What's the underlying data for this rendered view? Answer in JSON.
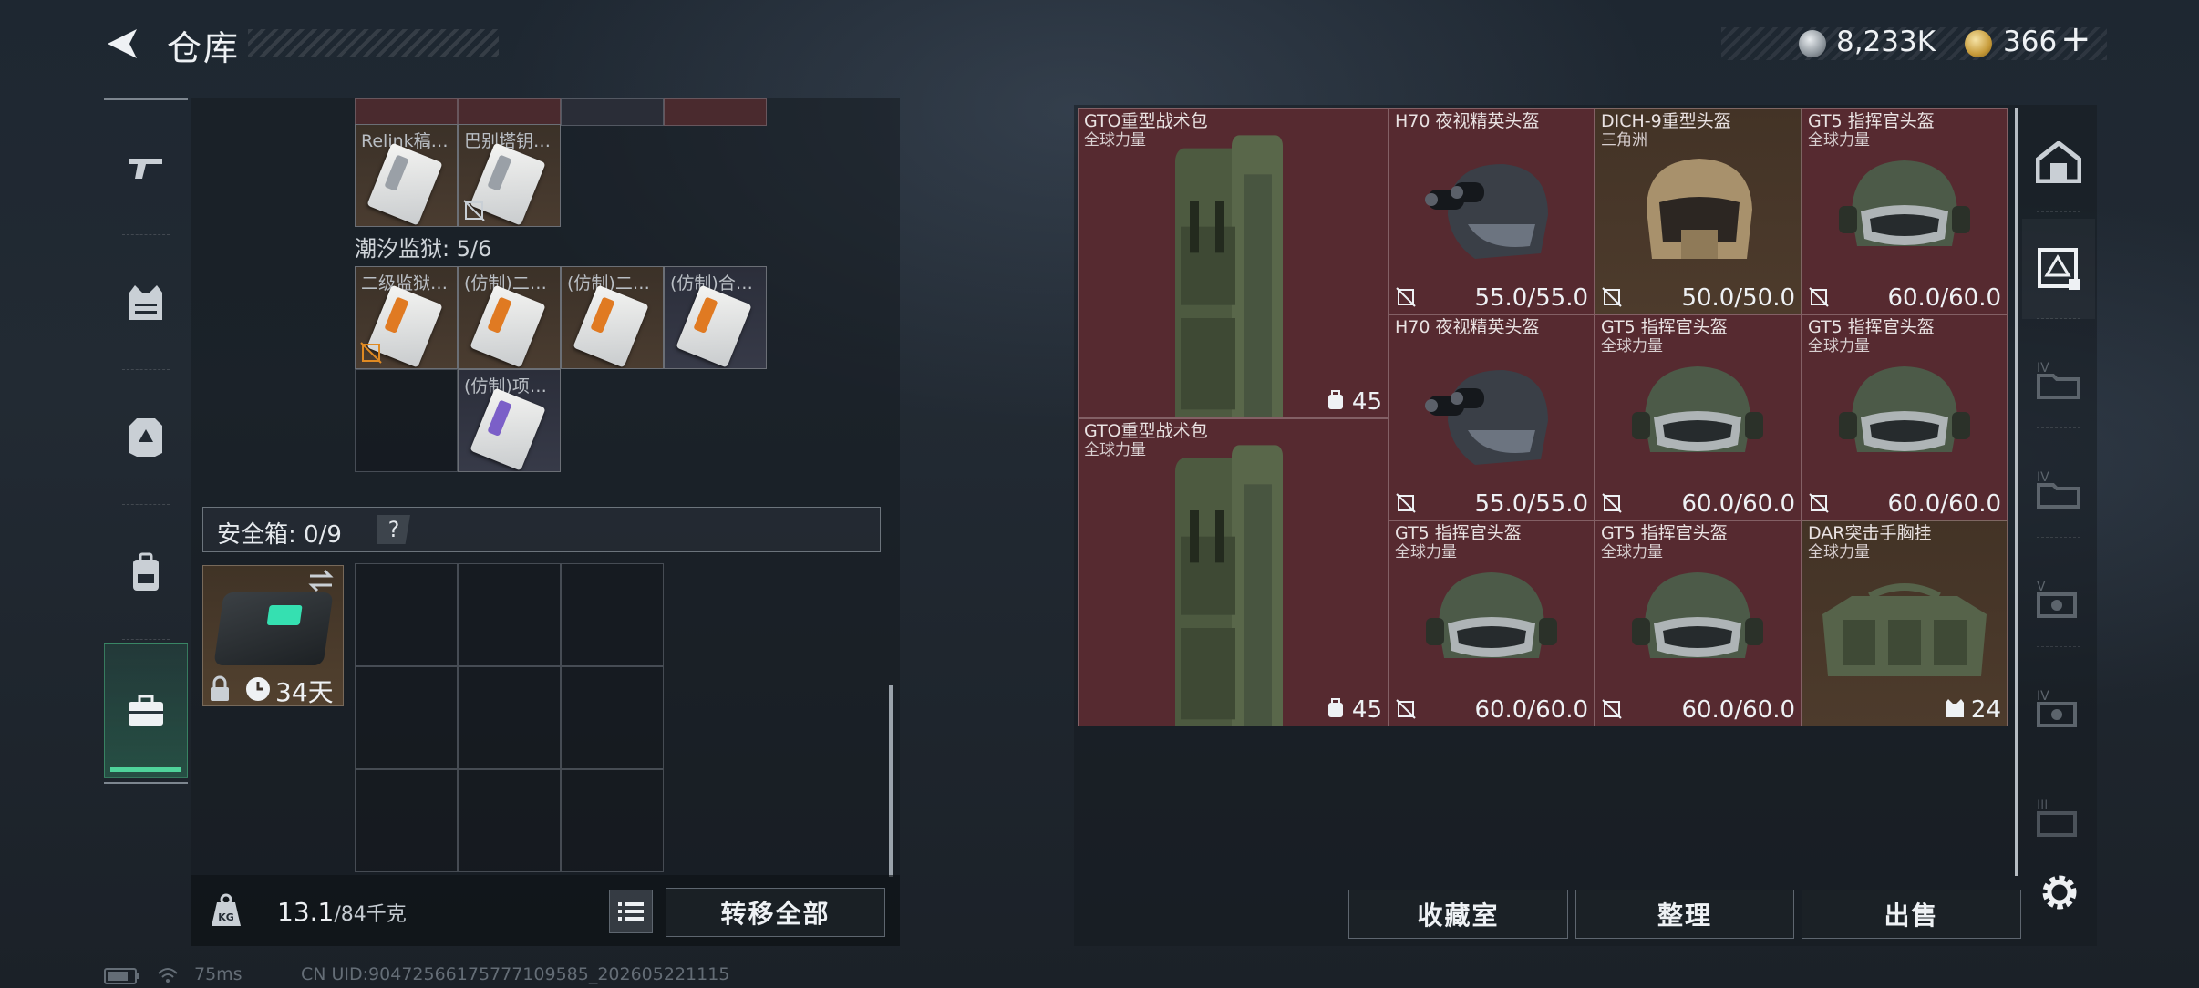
{
  "header": {
    "title": "仓库",
    "currency_silver": "8,233K",
    "currency_gold": "366",
    "plus_label": "+"
  },
  "left": {
    "top_cards": [
      {
        "name": "Relink稿…",
        "doc": "silver"
      },
      {
        "name": "巴别塔钥…",
        "doc": "silver"
      }
    ],
    "section_label": "潮汐监狱: 5/6",
    "section_cards": [
      {
        "name": "二级监狱…",
        "doc": "orange",
        "color": "brown"
      },
      {
        "name": "(仿制)二…",
        "doc": "orange",
        "color": "brown"
      },
      {
        "name": "(仿制)二…",
        "doc": "orange",
        "color": "brown"
      },
      {
        "name": "(仿制)合…",
        "doc": "orange",
        "color": "navy"
      },
      {
        "name": "(仿制)项…",
        "doc": "purple",
        "color": "navy"
      }
    ],
    "safebox_label": "安全箱: 0/9",
    "help_label": "?",
    "safebox_days": "34天",
    "weight_value": "13.1",
    "weight_unit": "/84千克",
    "transfer_all": "转移全部"
  },
  "stash": {
    "items": [
      {
        "name": "GTO重型战术包",
        "sub": "全球力量",
        "capacity": "45",
        "kind": "backpack"
      },
      {
        "name": "H70 夜视精英头盔",
        "sub": "",
        "durability": "55.0/55.0",
        "kind": "nvg"
      },
      {
        "name": "DICH-9重型头盔",
        "sub": "三角洲",
        "durability": "50.0/50.0",
        "kind": "dich"
      },
      {
        "name": "GT5 指挥官头盔",
        "sub": "全球力量",
        "durability": "60.0/60.0",
        "kind": "gt5"
      },
      {
        "name": "H70 夜视精英头盔",
        "sub": "",
        "durability": "55.0/55.0",
        "kind": "nvg"
      },
      {
        "name": "GT5 指挥官头盔",
        "sub": "全球力量",
        "durability": "60.0/60.0",
        "kind": "gt5"
      },
      {
        "name": "GT5 指挥官头盔",
        "sub": "全球力量",
        "durability": "60.0/60.0",
        "kind": "gt5"
      },
      {
        "name": "GTO重型战术包",
        "sub": "全球力量",
        "capacity": "45",
        "kind": "backpack"
      },
      {
        "name": "GT5 指挥官头盔",
        "sub": "全球力量",
        "durability": "60.0/60.0",
        "kind": "gt5"
      },
      {
        "name": "GT5 指挥官头盔",
        "sub": "全球力量",
        "durability": "60.0/60.0",
        "kind": "gt5"
      },
      {
        "name": "DAR突击手胸挂",
        "sub": "全球力量",
        "capacity": "24",
        "kind": "vest"
      }
    ],
    "btn_collection": "收藏室",
    "btn_sort": "整理",
    "btn_sell": "出售"
  },
  "status_bar": {
    "ping": "75ms",
    "uid": "CN UID:9047256617577710958​5_202605221115"
  },
  "colors": {
    "accent_green": "#4fd39b",
    "stash_red": "#562a30",
    "card_brown": "#4a3c30",
    "card_navy": "#373a48"
  }
}
